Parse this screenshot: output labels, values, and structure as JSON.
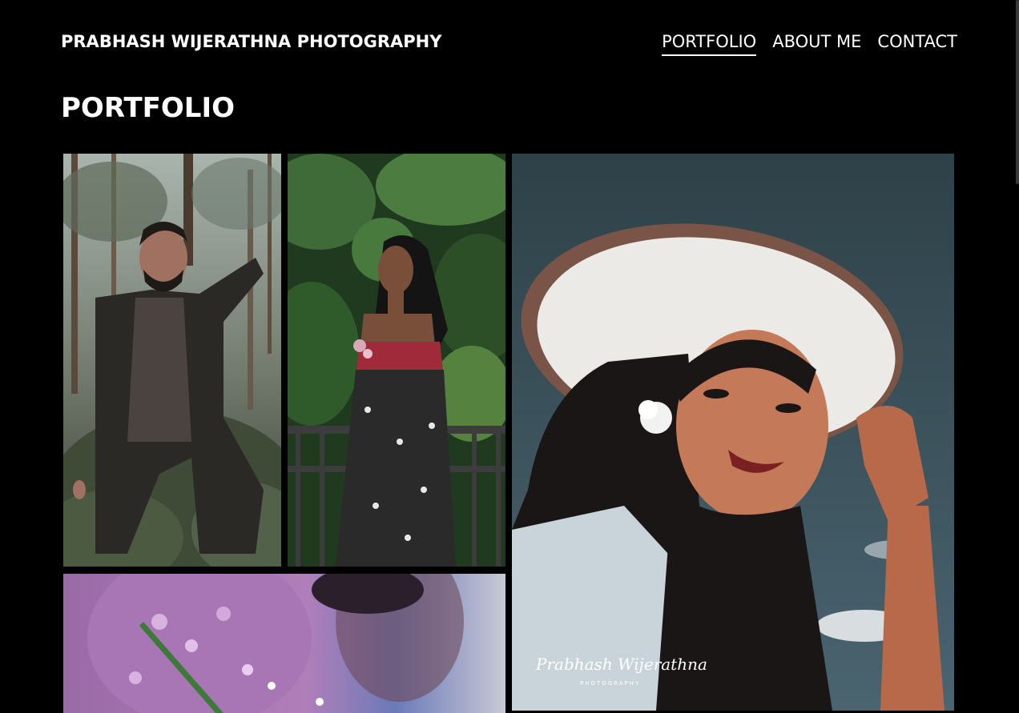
{
  "header": {
    "site_title": "PRABHASH WIJERATHNA PHOTOGRAPHY",
    "nav": [
      {
        "label": "PORTFOLIO",
        "active": true
      },
      {
        "label": "ABOUT ME",
        "active": false
      },
      {
        "label": "CONTACT",
        "active": false
      }
    ]
  },
  "main": {
    "heading": "PORTFOLIO",
    "gallery_watermark": {
      "name": "Prabhash Wijerathna",
      "sub": "PHOTOGRAPHY"
    }
  },
  "colors": {
    "background": "#000000",
    "text": "#ffffff"
  }
}
